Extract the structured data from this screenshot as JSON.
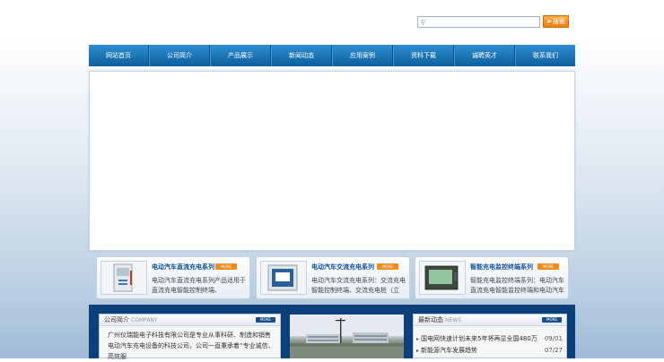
{
  "search": {
    "placeholder": "",
    "button_label": "搜索"
  },
  "nav": {
    "items": [
      "网站首页",
      "公司简介",
      "产品展示",
      "新闻动态",
      "应用案例",
      "资料下载",
      "诚聘英才",
      "联系我们"
    ]
  },
  "products": [
    {
      "title": "电动汽车直流充电系列",
      "more": "MORE",
      "desc": "电动汽车直流充电系列产品适用于直流充电智能控制终端、"
    },
    {
      "title": "电动汽车交流充电系列",
      "more": "MORE",
      "desc": "电动汽车交流充电系列：交流充电智能控制终端、交流充电桩（立"
    },
    {
      "title": "智能充电监控终端系列",
      "more": "MORE",
      "desc": "智能充电监控终端系列：电动汽车直流充电智能监控终端和电动汽车"
    }
  ],
  "about": {
    "title": "公司简介",
    "subtitle": "COMPANY",
    "more": "MORE",
    "text": "广州仪瑞能电子科技有限公司是专业从事科研、制造和销售电动汽车充电设备的科技公司，公司一直秉承着“专业诚信、高效服"
  },
  "news": {
    "title": "最新动态",
    "subtitle": "NEWS",
    "more": "MORE",
    "items": [
      {
        "text": "国电网快速计划未来5年将再显全国480万",
        "date": "09/01"
      },
      {
        "text": "新能源汽车发展趋势",
        "date": "07/27"
      }
    ]
  }
}
